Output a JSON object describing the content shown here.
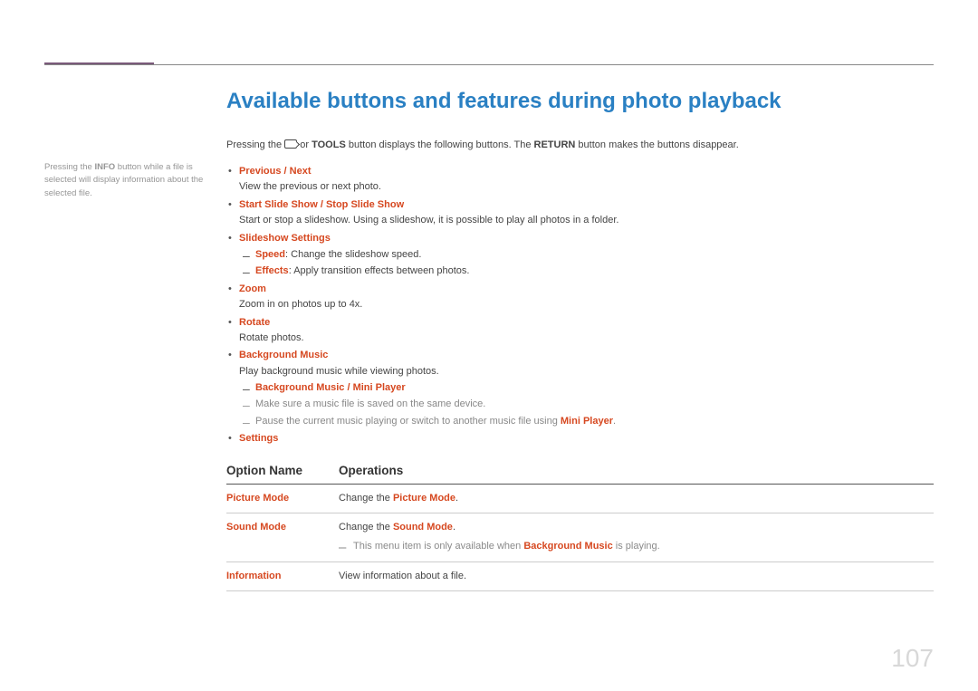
{
  "sidenote": {
    "pre": "Pressing the ",
    "bold": "INFO",
    "post": " button while a file is selected will display information about the selected file."
  },
  "title": "Available buttons and features during photo playback",
  "intro": {
    "t1": "Pressing the ",
    "t2": " or ",
    "b1": "TOOLS",
    "t3": " button displays the following buttons. The ",
    "b2": "RETURN",
    "t4": " button makes the buttons disappear."
  },
  "features": [
    {
      "term": "Previous / Next",
      "desc": "View the previous or next photo."
    },
    {
      "term": "Start Slide Show / Stop Slide Show",
      "desc": "Start or stop a slideshow. Using a slideshow, it is possible to play all photos in a folder."
    },
    {
      "term": "Slideshow Settings",
      "subs": [
        {
          "bold": "Speed",
          "rest": ": Change the slideshow speed."
        },
        {
          "bold": "Effects",
          "rest": ": Apply transition effects between photos."
        }
      ]
    },
    {
      "term": "Zoom",
      "desc": "Zoom in on photos up to 4x."
    },
    {
      "term": "Rotate",
      "desc": "Rotate photos."
    },
    {
      "term": "Background Music",
      "desc": "Play background music while viewing photos.",
      "subs2": [
        {
          "kind": "term",
          "text": "Background Music / Mini Player"
        },
        {
          "kind": "gray",
          "text": "Make sure a music file is saved on the same device."
        },
        {
          "kind": "gray_mixed",
          "pre": "Pause the current music playing or switch to another music file using ",
          "term": "Mini Player",
          "post": "."
        }
      ]
    },
    {
      "term": "Settings"
    }
  ],
  "table": {
    "head1": "Option Name",
    "head2": "Operations",
    "rows": [
      {
        "name": "Picture Mode",
        "op_pre": "Change the ",
        "op_term": "Picture Mode",
        "op_post": "."
      },
      {
        "name": "Sound Mode",
        "op_pre": "Change the ",
        "op_term": "Sound Mode",
        "op_post": ".",
        "note_pre": "This menu item is only available when ",
        "note_term": "Background Music",
        "note_post": " is playing."
      },
      {
        "name": "Information",
        "op_plain": "View information about a file."
      }
    ]
  },
  "page": "107"
}
